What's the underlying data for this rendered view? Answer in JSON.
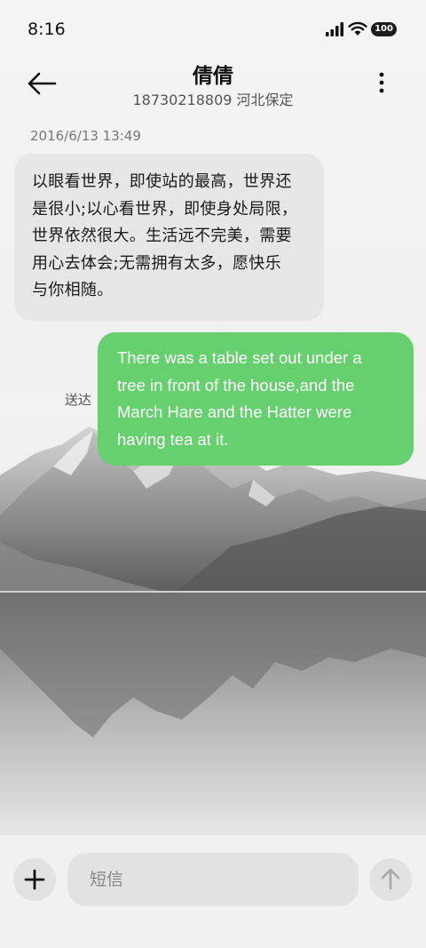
{
  "status_bar": {
    "time": "8:16",
    "battery": "100",
    "icons": [
      "signal-icon",
      "wifi-icon",
      "battery-icon"
    ]
  },
  "header": {
    "contact_name": "倩倩",
    "contact_detail": "18730218809 河北保定",
    "back_icon": "arrow-left-icon",
    "more_icon": "more-vertical-icon"
  },
  "conversation": {
    "timestamp": "2016/6/13 13:49",
    "messages": [
      {
        "direction": "incoming",
        "lines": [
          "以眼看世界，即使站的最高，世界还",
          "是很小;以心看世界，即使身处局限，",
          "世界依然很大。生活远不完美，需要",
          "用心去体会;无需拥有太多，愿快乐",
          "与你相随。"
        ]
      },
      {
        "direction": "outgoing",
        "lines": [
          "There was a table set out under a",
          "tree in front of the house,and the",
          "March Hare and the Hatter were",
          "having tea at it."
        ],
        "status": "送达"
      }
    ]
  },
  "composer": {
    "placeholder": "短信",
    "add_icon": "plus-icon",
    "send_icon": "arrow-up-icon"
  },
  "colors": {
    "outgoing_bubble": "#66cf6e",
    "incoming_bubble": "#e6e6e6"
  }
}
